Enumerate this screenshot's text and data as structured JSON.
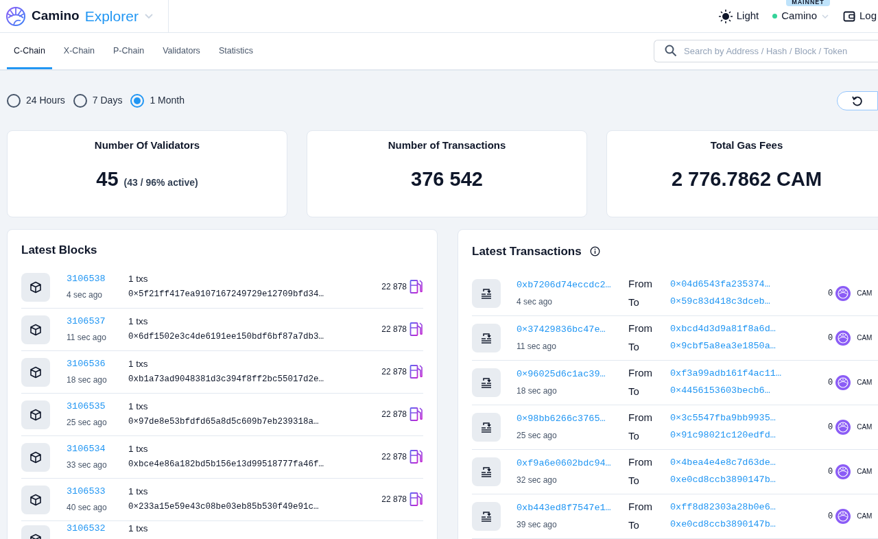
{
  "header": {
    "brand": "Camino",
    "product": "Explorer",
    "theme": "Light",
    "network": {
      "name": "Camino",
      "badge": "MAINNET",
      "online": true
    },
    "login": "Log"
  },
  "tabs": [
    {
      "label": "C-Chain",
      "selected": true
    },
    {
      "label": "X-Chain",
      "selected": false
    },
    {
      "label": "P-Chain",
      "selected": false
    },
    {
      "label": "Validators",
      "selected": false
    },
    {
      "label": "Statistics",
      "selected": false
    }
  ],
  "search": {
    "placeholder": "Search by Address / Hash / Block / Token"
  },
  "periods": [
    {
      "label": "24 Hours",
      "selected": false
    },
    {
      "label": "7 Days",
      "selected": false
    },
    {
      "label": "1 Month",
      "selected": true
    }
  ],
  "stats": [
    {
      "title": "Number Of Validators",
      "value": "45",
      "detail": "(43 / 96% active)"
    },
    {
      "title": "Number of Transactions",
      "value": "376 542"
    },
    {
      "title": "Total Gas Fees",
      "value": "2 776.7862 CAM"
    }
  ],
  "latest_blocks": {
    "title": "Latest Blocks",
    "rows": [
      {
        "number": "3106538",
        "age": "4 sec ago",
        "txs": "1 txs",
        "hash": "0×5f21ff417ea9107167249729e12709bfd34…",
        "gas": "22 878"
      },
      {
        "number": "3106537",
        "age": "11 sec ago",
        "txs": "1 txs",
        "hash": "0×6df1502e3c4de6191ee150bdf6bf87a7db3…",
        "gas": "22 878"
      },
      {
        "number": "3106536",
        "age": "18 sec ago",
        "txs": "1 txs",
        "hash": "0xb1a73ad9048381d3c394f8ff2bc55017d2e…",
        "gas": "22 878"
      },
      {
        "number": "3106535",
        "age": "25 sec ago",
        "txs": "1 txs",
        "hash": "0×97de8e53bfdfd65a8d5c609b7eb239318a…",
        "gas": "22 878"
      },
      {
        "number": "3106534",
        "age": "33 sec ago",
        "txs": "1 txs",
        "hash": "0xbce4e86a182bd5b156e13d99518777fa46f…",
        "gas": "22 878"
      },
      {
        "number": "3106533",
        "age": "40 sec ago",
        "txs": "1 txs",
        "hash": "0×233a15e59e43c08be03eb85b530f49e91c…",
        "gas": "22 878"
      },
      {
        "number": "3106532",
        "txs": "1 txs"
      }
    ]
  },
  "latest_transactions": {
    "title": "Latest Transactions",
    "rows": [
      {
        "hash": "0xb7206d74eccdc2…",
        "age": "4 sec ago",
        "from_label": "From",
        "from": "0×04d6543fa235374…",
        "to_label": "To",
        "to": "0×59c83d418c3dceb…",
        "amount": "0",
        "currency": "CAM"
      },
      {
        "hash": "0×37429836bc47e…",
        "age": "11 sec ago",
        "from_label": "From",
        "from": "0xbcd4d3d9a81f8a6d…",
        "to_label": "To",
        "to": "0×9cbf5a8ea3e1850a…",
        "amount": "0",
        "currency": "CAM"
      },
      {
        "hash": "0×96025d6c1ac39…",
        "age": "18 sec ago",
        "from_label": "From",
        "from": "0xf3a99adb161f4ac11…",
        "to_label": "To",
        "to": "0×4456153603becb6…",
        "amount": "0",
        "currency": "CAM"
      },
      {
        "hash": "0×98bb6266c3765…",
        "age": "25 sec ago",
        "from_label": "From",
        "from": "0×3c5547fba9bb9935…",
        "to_label": "To",
        "to": "0×91c98021c120edfd…",
        "amount": "0",
        "currency": "CAM"
      },
      {
        "hash": "0xf9a6e0602bdc94…",
        "age": "32 sec ago",
        "from_label": "From",
        "from": "0×4bea4e4e8c7d63de…",
        "to_label": "To",
        "to": "0xe0cd8ccb3890147b…",
        "amount": "0",
        "currency": "CAM"
      },
      {
        "hash": "0xb443ed8f7547e1…",
        "age": "39 sec ago",
        "from_label": "From",
        "from": "0xff8d82303a28b0e6…",
        "to_label": "To",
        "to": "0xe0cd8ccb3890147b…",
        "amount": "0",
        "currency": "CAM"
      }
    ]
  }
}
